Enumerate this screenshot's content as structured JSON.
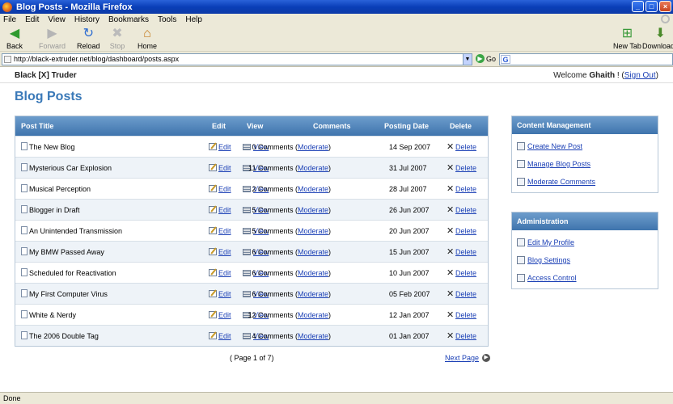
{
  "window": {
    "title": "Blog Posts - Mozilla Firefox"
  },
  "menu": [
    "File",
    "Edit",
    "View",
    "History",
    "Bookmarks",
    "Tools",
    "Help"
  ],
  "toolbar": {
    "back": "Back",
    "forward": "Forward",
    "reload": "Reload",
    "stop": "Stop",
    "home": "Home",
    "new_tab": "New Tab",
    "downloads": "Downloads"
  },
  "address": {
    "url": "http://black-extruder.net/blog/dashboard/posts.aspx",
    "go": "Go",
    "search_engine": "G"
  },
  "header": {
    "brand": "Black [X] Truder",
    "welcome_prefix": "Welcome ",
    "user": "Ghaith",
    "welcome_mid": " ! (",
    "sign_out": "Sign Out",
    "welcome_suffix": ")"
  },
  "page": {
    "title": "Blog Posts"
  },
  "table": {
    "columns": [
      "Post Title",
      "Edit",
      "View",
      "Comments",
      "Posting Date",
      "Delete"
    ],
    "edit_label": "Edit",
    "view_label": "View",
    "delete_label": "Delete",
    "moderate_label": "Moderate",
    "rows": [
      {
        "title": "The New Blog",
        "comments": "0 Comments (",
        "date": "14 Sep 2007"
      },
      {
        "title": "Mysterious Car Explosion",
        "comments": "11 Comments (",
        "date": "31 Jul 2007"
      },
      {
        "title": "Musical Perception",
        "comments": "2 Comments (",
        "date": "28 Jul 2007"
      },
      {
        "title": "Blogger in Draft",
        "comments": "5 Comments (",
        "date": "26 Jun 2007"
      },
      {
        "title": "An Unintended Transmission",
        "comments": "5 Comments (",
        "date": "20 Jun 2007"
      },
      {
        "title": "My BMW Passed Away",
        "comments": "6 Comments (",
        "date": "15 Jun 2007"
      },
      {
        "title": "Scheduled for Reactivation",
        "comments": "6 Comments (",
        "date": "10 Jun 2007"
      },
      {
        "title": "My First Computer Virus",
        "comments": "6 Comments (",
        "date": "05 Feb 2007"
      },
      {
        "title": "White & Nerdy",
        "comments": "12 Comments (",
        "date": "12 Jan 2007"
      },
      {
        "title": "The 2006 Double Tag",
        "comments": "4 Comments (",
        "date": "01 Jan 2007"
      }
    ]
  },
  "pager": {
    "text": "( Page 1 of 7)",
    "next": "Next Page"
  },
  "content_panel": {
    "title": "Content Management",
    "items": [
      "Create New Post",
      "Manage Blog Posts",
      "Moderate Comments"
    ]
  },
  "admin_panel": {
    "title": "Administration",
    "items": [
      "Edit My Profile",
      "Blog Settings",
      "Access Control"
    ]
  },
  "status": "Done",
  "colors": {
    "accent": "#3a79b8",
    "link": "#1a3fb5",
    "header_grad_top": "#6d9dcc",
    "header_grad_bottom": "#3f74ad"
  }
}
